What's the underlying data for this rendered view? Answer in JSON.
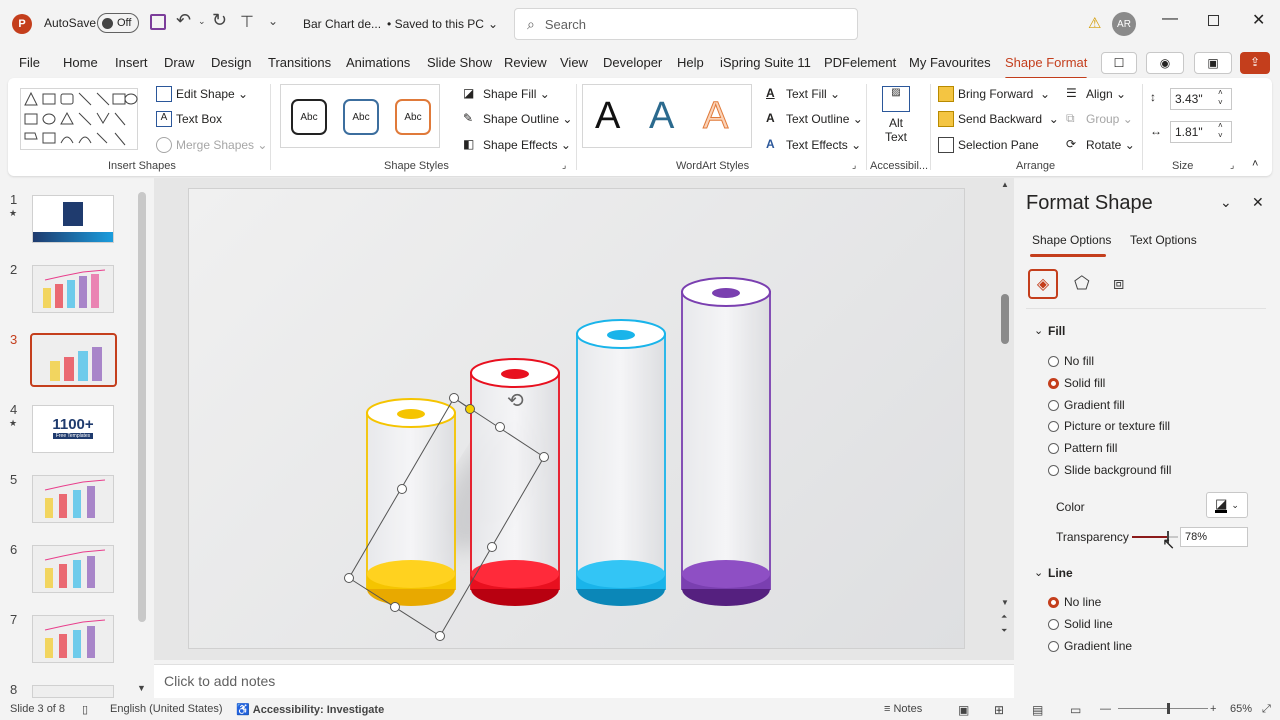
{
  "titlebar": {
    "autosave_label": "AutoSave",
    "autosave_state": "Off",
    "doc_title": "Bar Chart de...",
    "save_status": "• Saved to this PC",
    "search_placeholder": "Search",
    "user_initials": "AR"
  },
  "tabs": [
    "File",
    "Home",
    "Insert",
    "Draw",
    "Design",
    "Transitions",
    "Animations",
    "Slide Show",
    "Review",
    "View",
    "Developer",
    "Help",
    "iSpring Suite 11",
    "PDFelement",
    "My Favourites",
    "Shape Format"
  ],
  "ribbon": {
    "insert_shapes": {
      "edit_shape": "Edit Shape",
      "text_box": "Text Box",
      "merge_shapes": "Merge Shapes",
      "label": "Insert Shapes"
    },
    "shape_styles": {
      "abc": "Abc",
      "fill": "Shape Fill",
      "outline": "Shape Outline",
      "effects": "Shape Effects",
      "label": "Shape Styles"
    },
    "wordart": {
      "letter": "A",
      "text_fill": "Text Fill",
      "text_outline": "Text Outline",
      "text_effects": "Text Effects",
      "label": "WordArt Styles"
    },
    "accessibility": {
      "alt_text_1": "Alt",
      "alt_text_2": "Text",
      "label": "Accessibil..."
    },
    "arrange": {
      "bring_forward": "Bring Forward",
      "send_backward": "Send Backward",
      "selection_pane": "Selection Pane",
      "align": "Align",
      "group": "Group",
      "rotate": "Rotate",
      "label": "Arrange"
    },
    "size": {
      "height": "3.43\"",
      "width": "1.81\"",
      "label": "Size"
    }
  },
  "slides": [
    {
      "num": "1",
      "star": "★"
    },
    {
      "num": "2",
      "star": ""
    },
    {
      "num": "3",
      "star": ""
    },
    {
      "num": "4",
      "star": "★",
      "text": "1100+",
      "subtext": "Free Templates"
    },
    {
      "num": "5",
      "star": ""
    },
    {
      "num": "6",
      "star": ""
    },
    {
      "num": "7",
      "star": ""
    },
    {
      "num": "8",
      "star": ""
    }
  ],
  "notes_placeholder": "Click to add notes",
  "format_pane": {
    "title": "Format Shape",
    "tab_shape": "Shape Options",
    "tab_text": "Text Options",
    "fill_header": "Fill",
    "fill_options": [
      "No fill",
      "Solid fill",
      "Gradient fill",
      "Picture or texture fill",
      "Pattern fill",
      "Slide background fill"
    ],
    "fill_selected": 1,
    "color_label": "Color",
    "transparency_label": "Transparency",
    "transparency_value": "78%",
    "transparency_fraction": 0.78,
    "line_header": "Line",
    "line_options": [
      "No line",
      "Solid line",
      "Gradient line"
    ],
    "line_selected": 0
  },
  "status": {
    "slide_info": "Slide 3 of 8",
    "language": "English (United States)",
    "accessibility": "Accessibility: Investigate",
    "notes": "Notes",
    "zoom": "65%"
  },
  "colors": {
    "accent": "#c43e1c",
    "yellow": "#f5c400",
    "red": "#e8101f",
    "blue": "#19b4ea",
    "purple": "#7a3fb0"
  }
}
